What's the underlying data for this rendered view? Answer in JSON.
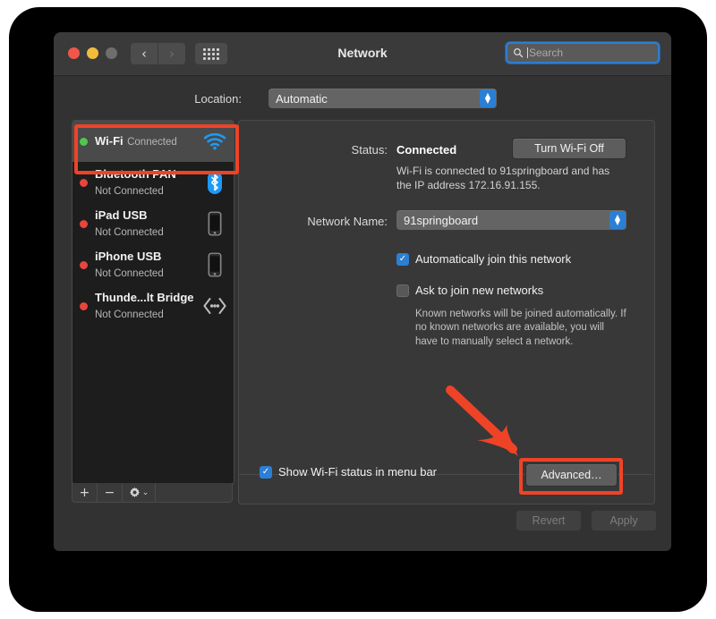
{
  "window": {
    "title": "Network",
    "traffic_lights": [
      "close",
      "minimize",
      "zoom"
    ],
    "nav_back": "‹",
    "nav_forward": "›",
    "grid_button": "show-all"
  },
  "search": {
    "placeholder": "Search",
    "icon": "search-icon",
    "focused": true
  },
  "location": {
    "label": "Location:",
    "value": "Automatic"
  },
  "sidebar": {
    "items": [
      {
        "name": "Wi-Fi",
        "status": "Connected",
        "dot": "green",
        "icon": "wifi-icon",
        "selected": true
      },
      {
        "name": "Bluetooth PAN",
        "status": "Not Connected",
        "dot": "red",
        "icon": "bluetooth-icon",
        "selected": false
      },
      {
        "name": "iPad USB",
        "status": "Not Connected",
        "dot": "red",
        "icon": "ipad-icon",
        "selected": false
      },
      {
        "name": "iPhone USB",
        "status": "Not Connected",
        "dot": "red",
        "icon": "iphone-icon",
        "selected": false
      },
      {
        "name": "Thunde...lt Bridge",
        "status": "Not Connected",
        "dot": "red",
        "icon": "thunderbolt-icon",
        "selected": false
      }
    ],
    "footer": {
      "add": "+",
      "remove": "−",
      "gear": "gear-icon",
      "gear_chevron": "⌄"
    }
  },
  "main": {
    "status_label": "Status:",
    "status_value": "Connected",
    "turn_off_button": "Turn Wi-Fi Off",
    "status_detail": "Wi-Fi is connected to 91springboard and has the IP address 172.16.91.155.",
    "network_name_label": "Network Name:",
    "network_name_value": "91springboard",
    "auto_join_label": "Automatically join this network",
    "auto_join_checked": true,
    "ask_join_label": "Ask to join new networks",
    "ask_join_checked": false,
    "known_networks_note": "Known networks will be joined automatically. If no known networks are available, you will have to manually select a network.",
    "show_status_label": "Show Wi-Fi status in menu bar",
    "show_status_checked": true,
    "advanced_button": "Advanced…",
    "help_button": "?"
  },
  "footer": {
    "revert_button": "Revert",
    "apply_button": "Apply"
  },
  "annotations": {
    "highlight_wifi_row": true,
    "highlight_advanced_button": true,
    "arrow": "red-arrow-pointing-to-advanced",
    "color": "#EF4327"
  }
}
